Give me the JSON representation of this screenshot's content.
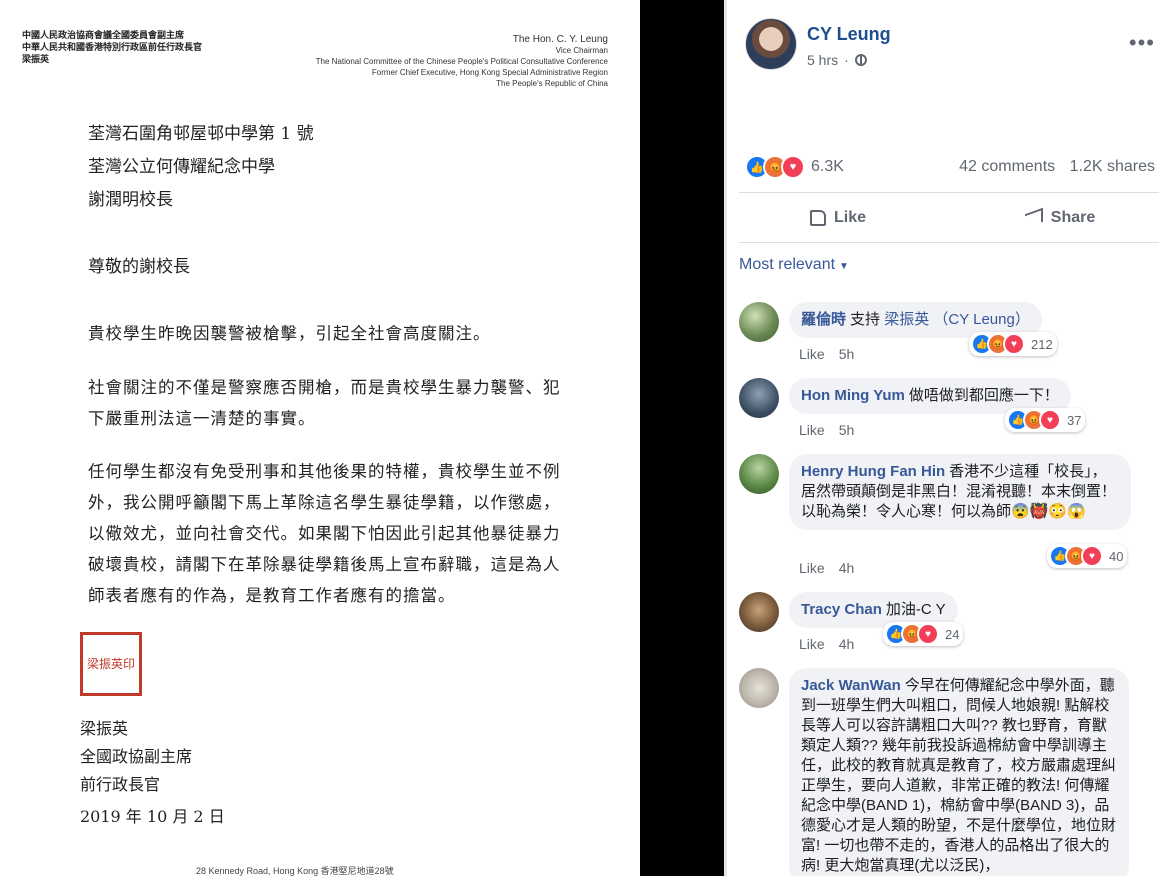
{
  "letter": {
    "letterhead_zh": [
      "中國人民政治協商會議全國委員會副主席",
      "中華人民共和國香港特別行政區前任行政長官",
      "梁振英"
    ],
    "letterhead_en": [
      "The Hon. C. Y. Leung",
      "Vice Chairman",
      "The National Committee of the Chinese People's Political Consultative Conference",
      "Former Chief Executive, Hong Kong Special Administrative Region",
      "The People's Republic of China"
    ],
    "address": [
      "荃灣石圍角邨屋邨中學第 1 號",
      "荃灣公立何傳耀紀念中學",
      "謝潤明校長"
    ],
    "salutation": "尊敬的謝校長",
    "paragraphs": [
      "貴校學生昨晚因襲警被槍擊，引起全社會高度關注。",
      "社會關注的不僅是警察應否開槍，而是貴校學生暴力襲警、犯下嚴重刑法這一清楚的事實。",
      "任何學生都沒有免受刑事和其他後果的特權，貴校學生並不例外，我公開呼籲閣下馬上革除這名學生暴徒學籍，以作懲處，以儆效尤，並向社會交代。如果閣下怕因此引起其他暴徒暴力破壞貴校，請閣下在革除暴徒學籍後馬上宣布辭職，這是為人師表者應有的作為，是教育工作者應有的擔當。"
    ],
    "seal_text": "梁振英印",
    "signature": [
      "梁振英",
      "全國政協副主席",
      "前行政長官"
    ],
    "date": "2019 年 10 月 2 日",
    "footer_address": "28 Kennedy Road, Hong Kong   香港堅尼地道28號"
  },
  "post": {
    "author": "CY Leung",
    "time": "5 hrs",
    "more_icon": "more-dots-icon",
    "reactions_count": "6.3K",
    "comments_count": "42 comments",
    "shares_count": "1.2K shares",
    "like_label": "Like",
    "share_label": "Share",
    "sort_label": "Most relevant"
  },
  "comments": [
    {
      "name": "羅倫時",
      "text": "支持",
      "mention": "梁振英 （CY Leung）",
      "like": "Like",
      "time": "5h",
      "reactions": "212"
    },
    {
      "name": "Hon Ming Yum",
      "text": "做唔做到都回應一下！",
      "like": "Like",
      "time": "5h",
      "reactions": "37"
    },
    {
      "name": "Henry Hung Fan Hin",
      "text": "香港不少這種「校長」，居然帶頭顛倒是非黑白！混淆視聽！本末倒置！以恥為榮！令人心寒！何以為師😨👹😳😱",
      "like": "Like",
      "time": "4h",
      "reactions": "40"
    },
    {
      "name": "Tracy Chan",
      "text": "加油-C Y",
      "like": "Like",
      "time": "4h",
      "reactions": "24"
    },
    {
      "name": "Jack WanWan",
      "text": "今早在何傳耀紀念中學外面，聽到一班學生們大叫粗口，問候人地娘親! 點解校長等人可以容許講粗口大叫?? 教乜野育，育獸類定人類?? 幾年前我投訴過棉紡會中學訓導主任，此校的教育就真是教育了，校方嚴肅處理糾正學生，要向人道歉，非常正確的教法! 何傳耀紀念中學(BAND 1)，棉紡會中學(BAND 3)，品德愛心才是人類的盼望，不是什麼學位，地位財富! 一切也帶不走的，香港人的品格出了很大的病! 更大炮當真理(尤以泛民)，"
    }
  ],
  "colors": {
    "link": "#385898",
    "name": "#1d4e8f",
    "like_blue": "#1877f2",
    "angry": "#e8743b",
    "love": "#f33e58",
    "seal": "#c0392b"
  }
}
